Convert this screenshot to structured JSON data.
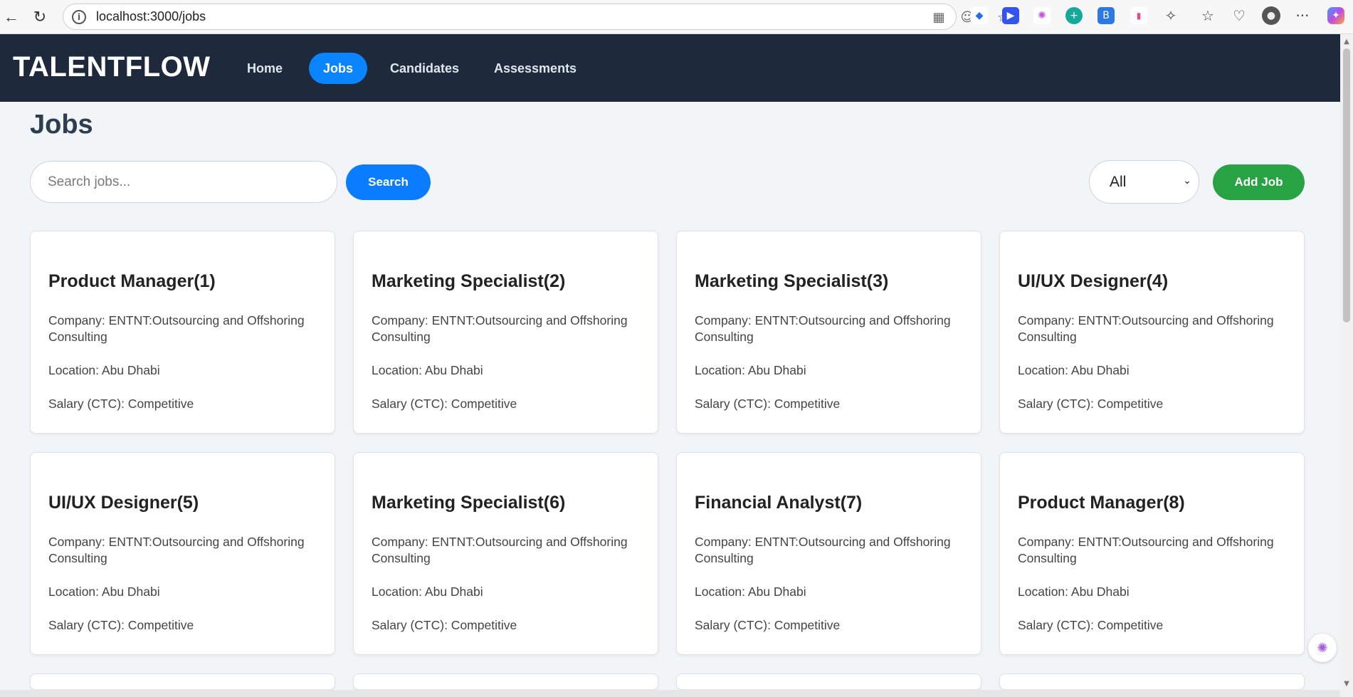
{
  "browser": {
    "url": "localhost:3000/jobs",
    "back_icon": "←",
    "reload_icon": "↻",
    "info_icon": "i",
    "menu_icon": "···"
  },
  "header": {
    "brand": "TALENTFLOW",
    "nav": [
      {
        "label": "Home",
        "active": false
      },
      {
        "label": "Jobs",
        "active": true
      },
      {
        "label": "Candidates",
        "active": false
      },
      {
        "label": "Assessments",
        "active": false
      }
    ]
  },
  "main": {
    "title": "Jobs",
    "search_placeholder": "Search jobs...",
    "search_button": "Search",
    "status_filter": "All",
    "add_button": "Add Job"
  },
  "jobs": [
    {
      "title": "Product Manager(1)",
      "company": "Company: ENTNT:Outsourcing and Offshoring Consulting",
      "location": "Location: Abu Dhabi",
      "salary": "Salary (CTC): Competitive"
    },
    {
      "title": "Marketing Specialist(2)",
      "company": "Company: ENTNT:Outsourcing and Offshoring Consulting",
      "location": "Location: Abu Dhabi",
      "salary": "Salary (CTC): Competitive"
    },
    {
      "title": "Marketing Specialist(3)",
      "company": "Company: ENTNT:Outsourcing and Offshoring Consulting",
      "location": "Location: Abu Dhabi",
      "salary": "Salary (CTC): Competitive"
    },
    {
      "title": "UI/UX Designer(4)",
      "company": "Company: ENTNT:Outsourcing and Offshoring Consulting",
      "location": "Location: Abu Dhabi",
      "salary": "Salary (CTC): Competitive"
    },
    {
      "title": "UI/UX Designer(5)",
      "company": "Company: ENTNT:Outsourcing and Offshoring Consulting",
      "location": "Location: Abu Dhabi",
      "salary": "Salary (CTC): Competitive"
    },
    {
      "title": "Marketing Specialist(6)",
      "company": "Company: ENTNT:Outsourcing and Offshoring Consulting",
      "location": "Location: Abu Dhabi",
      "salary": "Salary (CTC): Competitive"
    },
    {
      "title": "Financial Analyst(7)",
      "company": "Company: ENTNT:Outsourcing and Offshoring Consulting",
      "location": "Location: Abu Dhabi",
      "salary": "Salary (CTC): Competitive"
    },
    {
      "title": "Product Manager(8)",
      "company": "Company: ENTNT:Outsourcing and Offshoring Consulting",
      "location": "Location: Abu Dhabi",
      "salary": "Salary (CTC): Competitive"
    }
  ],
  "colors": {
    "header_bg": "#1e293b",
    "active_nav": "#0a84ff",
    "search_button": "#0a7cff",
    "add_button": "#27a344",
    "page_bg": "#f2f5f8"
  }
}
